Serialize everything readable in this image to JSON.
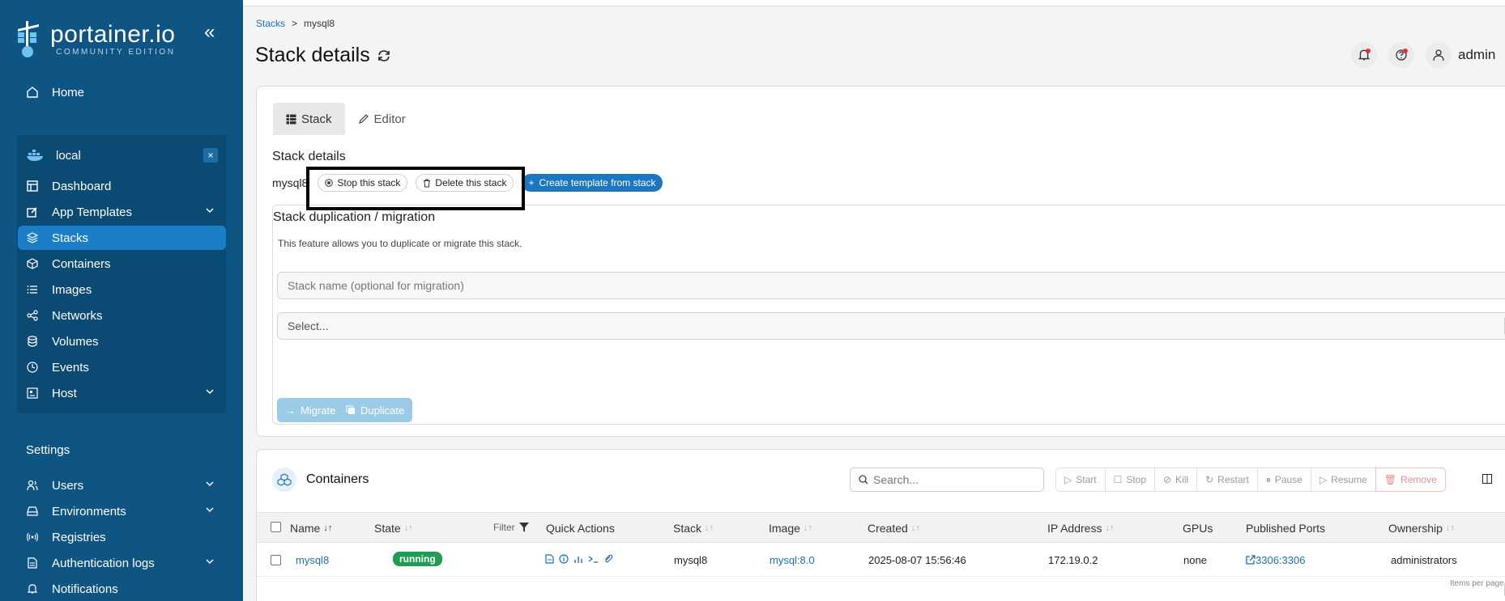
{
  "sidebar": {
    "logo_title": "portainer.io",
    "logo_sub": "COMMUNITY EDITION",
    "home": "Home",
    "env_name": "local",
    "env_close": "×",
    "items": [
      {
        "label": "Dashboard"
      },
      {
        "label": "App Templates"
      },
      {
        "label": "Stacks"
      },
      {
        "label": "Containers"
      },
      {
        "label": "Images"
      },
      {
        "label": "Networks"
      },
      {
        "label": "Volumes"
      },
      {
        "label": "Events"
      },
      {
        "label": "Host"
      }
    ],
    "settings_label": "Settings",
    "settings_items": [
      {
        "label": "Users"
      },
      {
        "label": "Environments"
      },
      {
        "label": "Registries"
      },
      {
        "label": "Authentication logs"
      },
      {
        "label": "Notifications"
      }
    ],
    "accent": "#1a7fc6",
    "bg": "#0f5583"
  },
  "breadcrumb": {
    "root": "Stacks",
    "sep": ">",
    "current": "mysql8"
  },
  "page_title": "Stack details",
  "header": {
    "user": "admin"
  },
  "tabs": {
    "stack": "Stack",
    "editor": "Editor"
  },
  "stack_details": {
    "title": "Stack details",
    "name": "mysql8",
    "stop_label": "Stop this stack",
    "delete_label": "Delete this stack",
    "template_label": "Create template from stack"
  },
  "duplication": {
    "title": "Stack duplication / migration",
    "desc": "This feature allows you to duplicate or migrate this stack.",
    "name_placeholder": "Stack name (optional for migration)",
    "select_placeholder": "Select...",
    "migrate_label": "Migrate",
    "duplicate_label": "Duplicate"
  },
  "containers": {
    "title": "Containers",
    "search_placeholder": "Search...",
    "actions": [
      "Start",
      "Stop",
      "Kill",
      "Restart",
      "Pause",
      "Resume",
      "Remove"
    ],
    "filter_label": "Filter",
    "headers": {
      "name": "Name",
      "state": "State",
      "quick_actions": "Quick Actions",
      "stack": "Stack",
      "image": "Image",
      "created": "Created",
      "ip": "IP Address",
      "gpus": "GPUs",
      "ports": "Published Ports",
      "ownership": "Ownership"
    },
    "rows": [
      {
        "name": "mysql8",
        "state": "running",
        "stack": "mysql8",
        "image": "mysql:8.0",
        "created": "2025-08-07 15:56:46",
        "ip": "172.19.0.2",
        "gpus": "none",
        "ports": "3306:3306",
        "ownership": "administrators"
      }
    ],
    "pager_label": "Items per page"
  }
}
